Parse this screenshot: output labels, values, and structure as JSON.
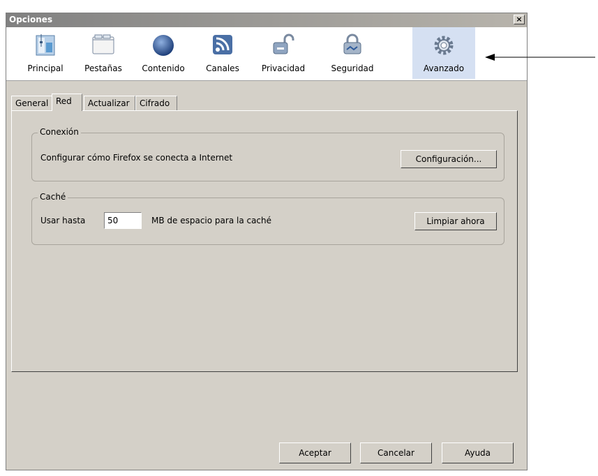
{
  "window": {
    "title": "Opciones",
    "close_label": "×"
  },
  "toolbar": {
    "items": [
      {
        "label": "Principal",
        "icon": "principal-icon"
      },
      {
        "label": "Pestañas",
        "icon": "tabs-icon"
      },
      {
        "label": "Contenido",
        "icon": "globe-icon"
      },
      {
        "label": "Canales",
        "icon": "rss-icon"
      },
      {
        "label": "Privacidad",
        "icon": "privacy-lock-icon"
      },
      {
        "label": "Seguridad",
        "icon": "security-lock-icon"
      },
      {
        "label": "Avanzado",
        "icon": "gear-icon",
        "selected": true
      }
    ]
  },
  "tabs": [
    {
      "label": "General"
    },
    {
      "label": "Red",
      "active": true
    },
    {
      "label": "Actualizar"
    },
    {
      "label": "Cifrado"
    }
  ],
  "connection": {
    "legend": "Conexión",
    "description": "Configurar cómo Firefox se conecta a Internet",
    "button": "Configuración..."
  },
  "cache": {
    "legend": "Caché",
    "label": "Usar hasta",
    "value": "50",
    "suffix": "MB de espacio para la caché",
    "button": "Limpiar ahora"
  },
  "footer": {
    "ok": "Aceptar",
    "cancel": "Cancelar",
    "help": "Ayuda"
  }
}
